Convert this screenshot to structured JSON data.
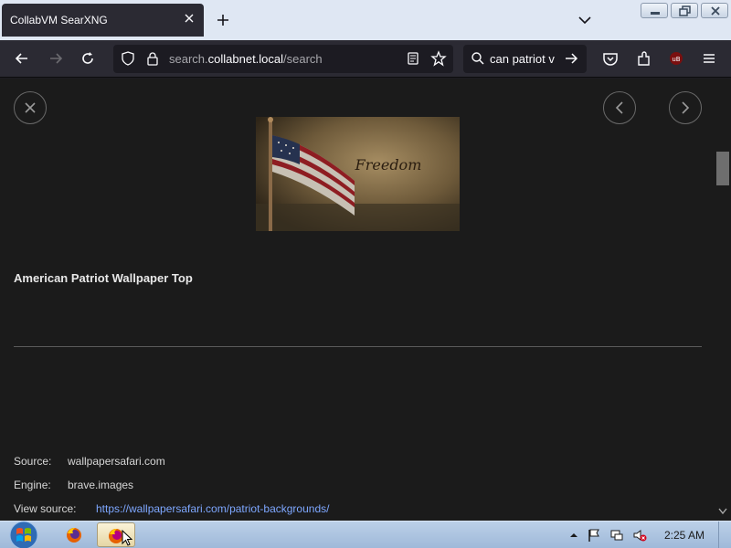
{
  "browser": {
    "tab_title": "CollabVM SearXNG",
    "url_domain": "search.collabnet.local",
    "url_path": "/search",
    "url_prefix": "search.",
    "url_host": "collabnet.local",
    "search_text": "can patriot v"
  },
  "preview": {
    "title": "American Patriot Wallpaper Top",
    "image_caption": "Freedom",
    "source_label": "Source:",
    "source_value": "wallpapersafari.com",
    "engine_label": "Engine:",
    "engine_value": "brave.images",
    "viewsource_label": "View source:",
    "viewsource_url": "https://wallpapersafari.com/patriot-backgrounds/"
  },
  "taskbar": {
    "clock": "2:25 AM"
  },
  "colors": {
    "accent_link": "#7ea7ff",
    "page_bg": "#1b1b1b"
  }
}
